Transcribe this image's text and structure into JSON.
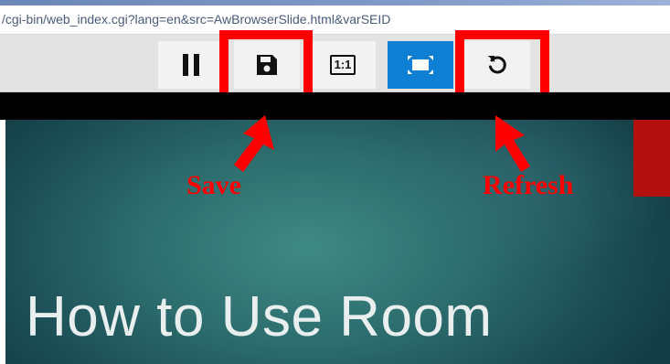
{
  "browser": {
    "address": "/cgi-bin/web_index.cgi?lang=en&src=AwBrowserSlide.html&varSEID"
  },
  "toolbar": {
    "buttons": [
      {
        "id": "pause",
        "icon": "pause-icon"
      },
      {
        "id": "save",
        "icon": "floppy-disk-icon"
      },
      {
        "id": "actual-size",
        "icon": "one-to-one-icon",
        "label": "1:1"
      },
      {
        "id": "fullscreen",
        "icon": "fullscreen-icon",
        "active": true
      },
      {
        "id": "refresh",
        "icon": "refresh-icon"
      }
    ]
  },
  "annotations": {
    "save_label": "Save",
    "refresh_label": "Refresh"
  },
  "slide": {
    "title": "How to Use Room"
  },
  "colors": {
    "toolbar_bg": "#e3e3e3",
    "button_bg": "#f2f2f2",
    "active_button": "#0f7fd4",
    "callout_red": "#ff0000",
    "slide_bg": "#2c6c6d",
    "slide_accent": "#b51010"
  }
}
